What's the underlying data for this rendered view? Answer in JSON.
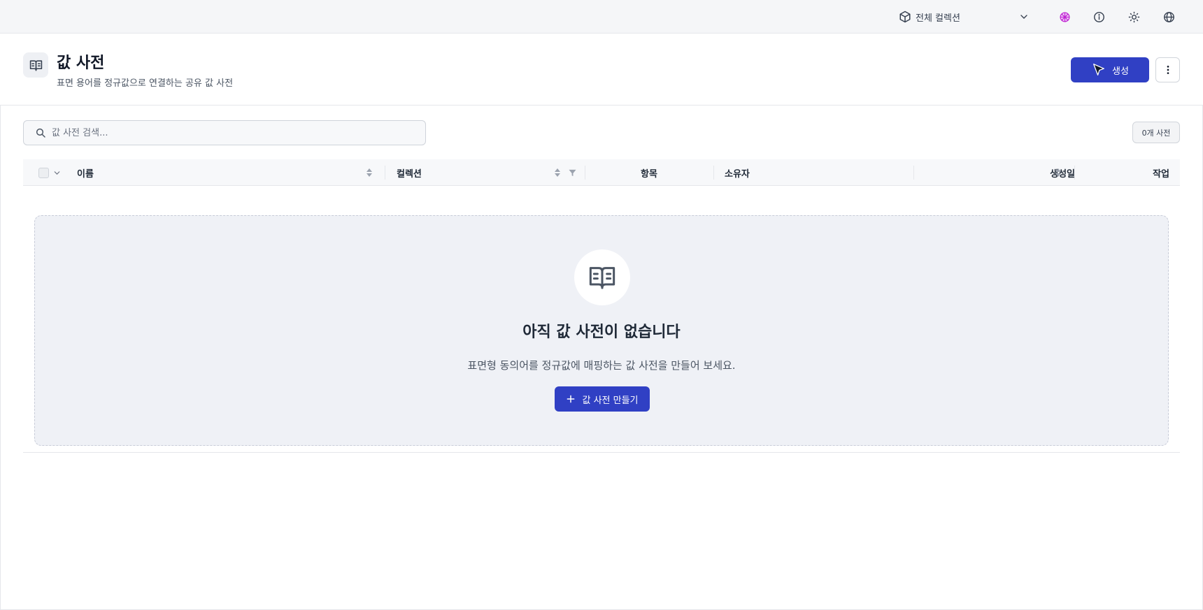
{
  "topbar": {
    "collection_select": {
      "value": "전체 컬렉션",
      "icon": "cube-icon"
    },
    "icons": [
      "ai-assistant-icon",
      "info-icon",
      "theme-sun-icon",
      "globe-icon"
    ],
    "ai_icon_color": "#c026d3"
  },
  "header": {
    "icon": "book-open-icon",
    "title": "값 사전",
    "subtitle": "표면 용어를 정규값으로 연결하는 공유 값 사전",
    "create_label": "생성",
    "more_icon": "more-vertical-icon"
  },
  "search": {
    "placeholder": "값 사전 검색...",
    "value": ""
  },
  "count_badge": "0개 사전",
  "table": {
    "columns": [
      {
        "key": "name",
        "label": "이름",
        "sortable": true
      },
      {
        "key": "collection",
        "label": "컬렉션",
        "sortable": true,
        "filterable": true
      },
      {
        "key": "items",
        "label": "항목"
      },
      {
        "key": "owner",
        "label": "소유자"
      },
      {
        "key": "created",
        "label": "생성일",
        "sortable": true
      },
      {
        "key": "actions",
        "label": "작업"
      }
    ],
    "rows": []
  },
  "empty_state": {
    "icon": "book-open-icon",
    "title": "아직 값 사전이 없습니다",
    "description": "표면형 동의어를 정규값에 매핑하는 값 사전을 만들어 보세요.",
    "button_label": "값 사전 만들기"
  },
  "colors": {
    "primary": "#3040c4",
    "empty_bg": "#eff1f6",
    "topbar_bg": "#f5f6f8"
  }
}
